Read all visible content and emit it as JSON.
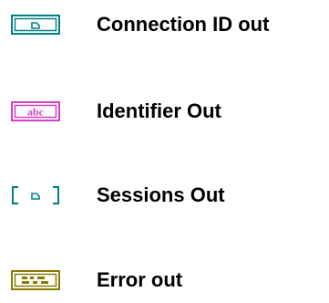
{
  "terminals": [
    {
      "label": "Connection ID out",
      "icon": "refnum-terminal-icon",
      "color": "#008080"
    },
    {
      "label": "Identifier Out",
      "icon": "string-terminal-icon",
      "color": "#d43fc0",
      "glyph": "abc"
    },
    {
      "label": "Sessions Out",
      "icon": "refnum-array-terminal-icon",
      "color": "#008080"
    },
    {
      "label": "Error out",
      "icon": "error-cluster-terminal-icon",
      "color": "#8a7a00"
    }
  ]
}
